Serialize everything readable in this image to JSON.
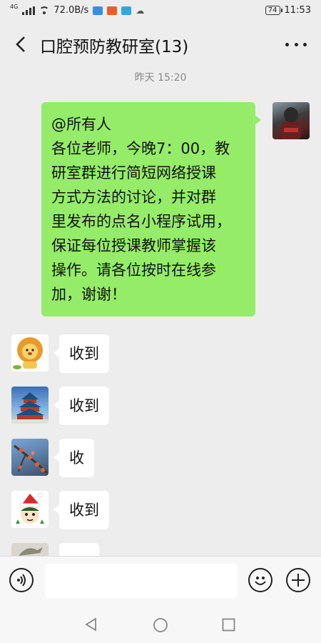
{
  "status_bar": {
    "network": "4G",
    "speed": "72.0B/s",
    "battery": "74",
    "time": "11:53"
  },
  "header": {
    "title": "口腔预防教研室(13)"
  },
  "chat": {
    "timestamp": "昨天 15:20",
    "messages": [
      {
        "side": "right",
        "lines": [
          "@所有人",
          "各位老师，今晚7：00，教",
          "研室群进行简短网络授课",
          "方式方法的讨论，并对群",
          "里发布的点名小程序试用，",
          "保证每位授课教师掌握该",
          "操作。请各位按时在线参",
          "加，谢谢！"
        ]
      },
      {
        "side": "left",
        "text": "收到",
        "avatar": "lion-avatar"
      },
      {
        "side": "left",
        "text": "收到",
        "avatar": "temple-avatar"
      },
      {
        "side": "left",
        "text": "收",
        "avatar": "flower-branch-avatar"
      },
      {
        "side": "left",
        "text": "收到",
        "avatar": "cartoon-boy-avatar"
      }
    ]
  },
  "input_bar": {
    "value": "",
    "placeholder": ""
  },
  "colors": {
    "background": "#ededed",
    "own_bubble": "#95ec69",
    "other_bubble": "#ffffff"
  }
}
